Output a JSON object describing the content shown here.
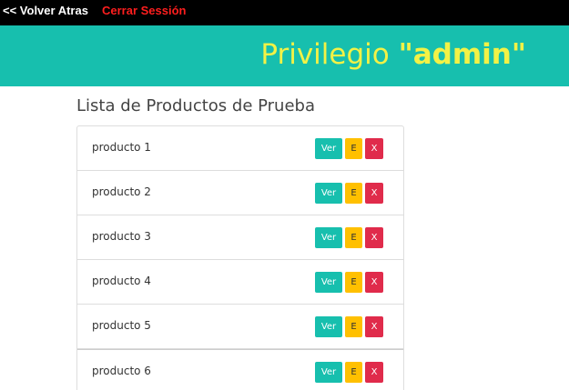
{
  "topbar": {
    "back_label": "<< Volver Atras",
    "logout_label": "Cerrar Sessión"
  },
  "banner": {
    "prefix": "Privilegio ",
    "role": "\"admin\""
  },
  "list": {
    "title": "Lista de Productos de Prueba",
    "items": [
      {
        "label": "producto 1",
        "view": "Ver",
        "edit": "E",
        "delete": "X"
      },
      {
        "label": "producto 2",
        "view": "Ver",
        "edit": "E",
        "delete": "X"
      },
      {
        "label": "producto 3",
        "view": "Ver",
        "edit": "E",
        "delete": "X"
      },
      {
        "label": "producto 4",
        "view": "Ver",
        "edit": "E",
        "delete": "X"
      },
      {
        "label": "producto 5",
        "view": "Ver",
        "edit": "E",
        "delete": "X"
      },
      {
        "label": "producto 6",
        "view": "Ver",
        "edit": "E",
        "delete": "X"
      }
    ]
  },
  "colors": {
    "topbar_bg": "#000000",
    "banner_bg": "#17bfae",
    "banner_text": "#f2f246",
    "logout_text": "#ff1e1e",
    "view_button": "#17bfae",
    "edit_button": "#ffc000",
    "delete_button": "#e02b4b"
  }
}
